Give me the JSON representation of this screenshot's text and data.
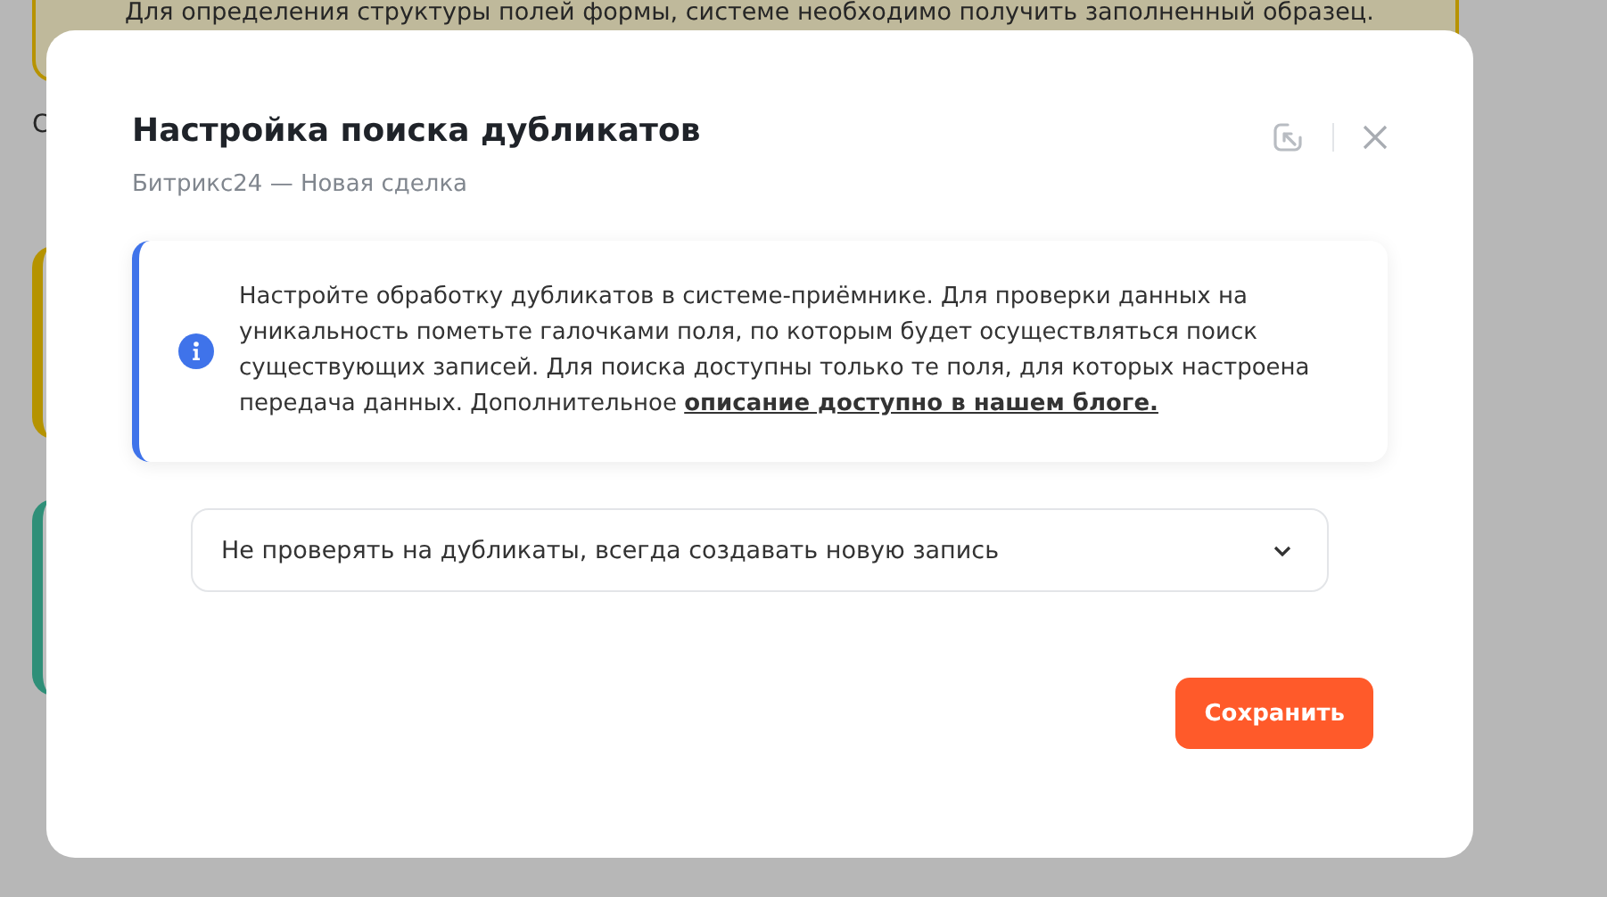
{
  "background": {
    "notice_text": "Для определения структуры полей формы, системе необходимо получить заполненный образец.",
    "side_text": "С"
  },
  "modal": {
    "title": "Настройка поиска дубликатов",
    "subtitle": "Битрикс24 — Новая сделка",
    "info": {
      "text": "Настройте обработку дубликатов в системе-приёмнике. Для проверки данных на уникальность пометьте галочками поля, по которым будет осуществляться поиск существующих записей. Для поиска доступны только те поля, для которых настроена передача данных. Дополнительное ",
      "link": "описание доступно в нашем блоге."
    },
    "select": {
      "value": "Не проверять на дубликаты, всегда создавать новую запись"
    },
    "save_button": "Сохранить"
  }
}
